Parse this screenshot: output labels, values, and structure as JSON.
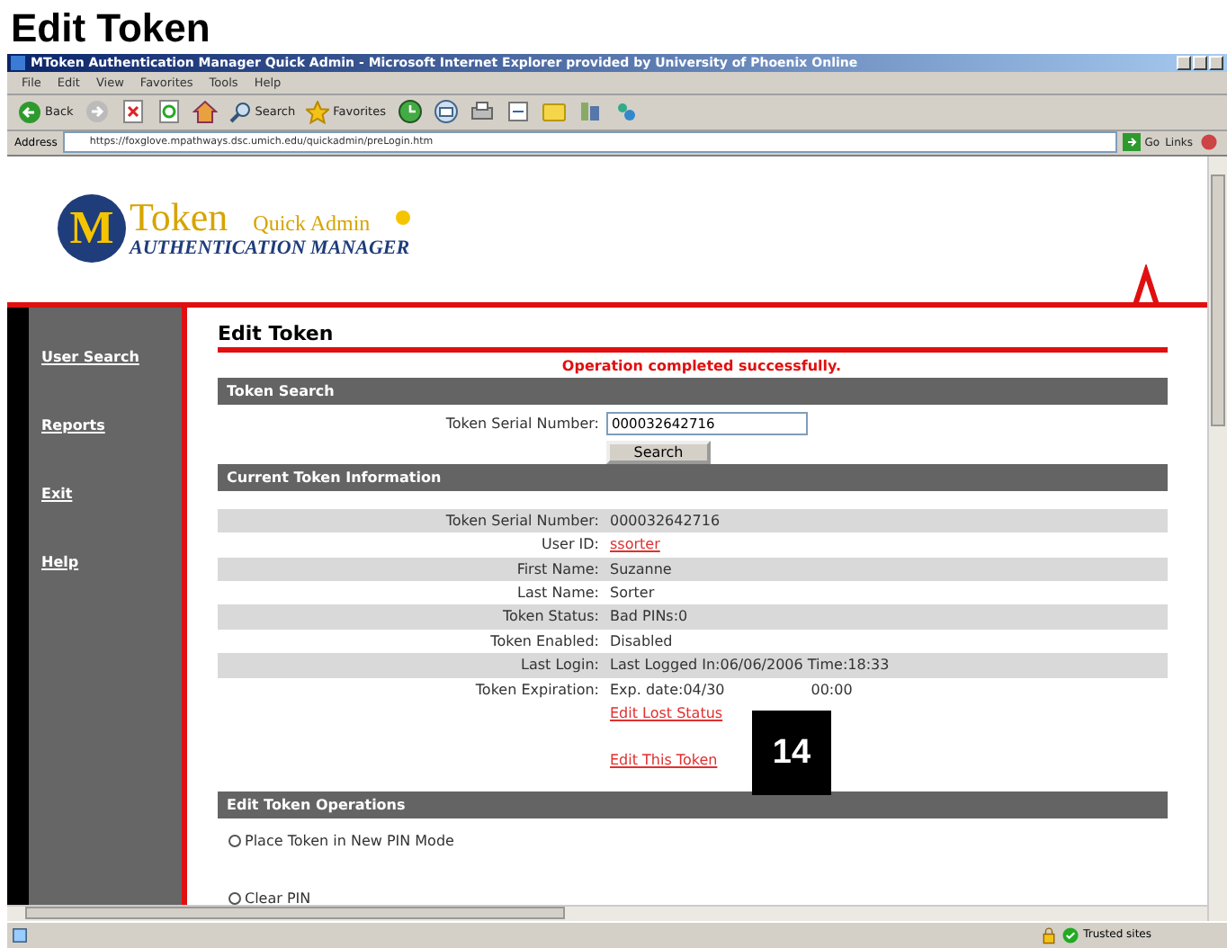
{
  "page_heading": "Edit Token",
  "browser": {
    "title": "MToken Authentication Manager Quick Admin - Microsoft Internet Explorer provided by University of Phoenix Online",
    "menu": [
      "File",
      "Edit",
      "View",
      "Favorites",
      "Tools",
      "Help"
    ],
    "toolbar": {
      "back": "Back",
      "search": "Search",
      "favorites": "Favorites"
    },
    "address_label": "Address",
    "url": "https://foxglove.mpathways.dsc.umich.edu/quickadmin/preLogin.htm",
    "go": "Go",
    "links": "Links"
  },
  "logo": {
    "letter": "M",
    "name": "Token",
    "subtitle": "Quick Admin",
    "tagline": "AUTHENTICATION MANAGER"
  },
  "sidebar": {
    "items": [
      "User Search",
      "Reports",
      "Exit",
      "Help"
    ]
  },
  "heading": "Edit Token",
  "message": "Operation completed successfully.",
  "token_search": {
    "title": "Token Search",
    "label": "Token Serial Number:",
    "value": "000032642716",
    "button": "Search"
  },
  "current_info": {
    "title": "Current Token Information",
    "rows": [
      {
        "label": "Token Serial Number:",
        "value": "000032642716",
        "kind": "text"
      },
      {
        "label": "User ID:",
        "value": "ssorter",
        "kind": "link"
      },
      {
        "label": "First Name:",
        "value": "Suzanne",
        "kind": "text"
      },
      {
        "label": "Last Name:",
        "value": "Sorter",
        "kind": "text"
      },
      {
        "label": "Token Status:",
        "value": "Bad PINs:0",
        "kind": "text"
      },
      {
        "label": "Token Enabled:",
        "value": "Disabled",
        "kind": "text"
      },
      {
        "label": "Last Login:",
        "value": "Last Logged In:06/06/2006 Time:18:33",
        "kind": "text"
      },
      {
        "label": "Token Expiration:",
        "value": "Exp. date:04/30",
        "value_tail": "00:00",
        "kind": "text"
      }
    ],
    "links": [
      "Edit Lost Status",
      "Edit This Token"
    ]
  },
  "operations": {
    "title": "Edit Token Operations",
    "options": [
      {
        "label": "Place Token in New PIN Mode",
        "checked": false
      },
      {
        "label": "Clear PIN",
        "checked": false
      }
    ]
  },
  "status_bar": {
    "zone": "Trusted sites"
  },
  "callout": "14"
}
